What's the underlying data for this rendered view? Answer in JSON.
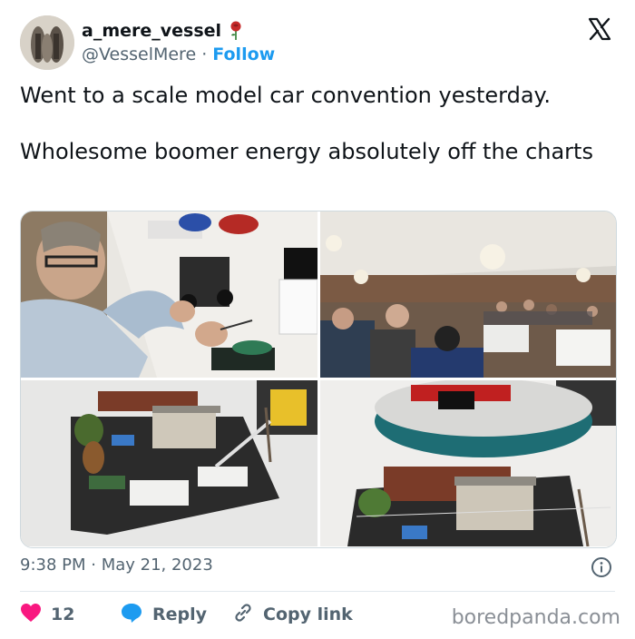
{
  "user": {
    "display_name": "a_mere_vessel",
    "handle": "@VesselMere",
    "separator": "·",
    "follow_label": "Follow"
  },
  "tweet": {
    "text": "Went to a scale model car convention yesterday.\n\nWholesome boomer energy absolutely off the charts",
    "timestamp": "9:38 PM · May 21, 2023"
  },
  "photos": [
    {
      "name": "photo-man-painting-model-car"
    },
    {
      "name": "photo-convention-hall-crowd"
    },
    {
      "name": "photo-diorama-utility-trucks"
    },
    {
      "name": "photo-diorama-railcar-shed"
    }
  ],
  "actions": {
    "like_count": "12",
    "reply_label": "Reply",
    "copy_link_label": "Copy link"
  },
  "watermark": "boredpanda.com",
  "colors": {
    "accent": "#1d9bf0",
    "like": "#f91880",
    "text": "#0f1419",
    "muted": "#536471"
  },
  "icons": [
    "x-logo-icon",
    "rose-icon",
    "info-icon",
    "heart-icon",
    "reply-bubble-icon",
    "link-icon"
  ]
}
